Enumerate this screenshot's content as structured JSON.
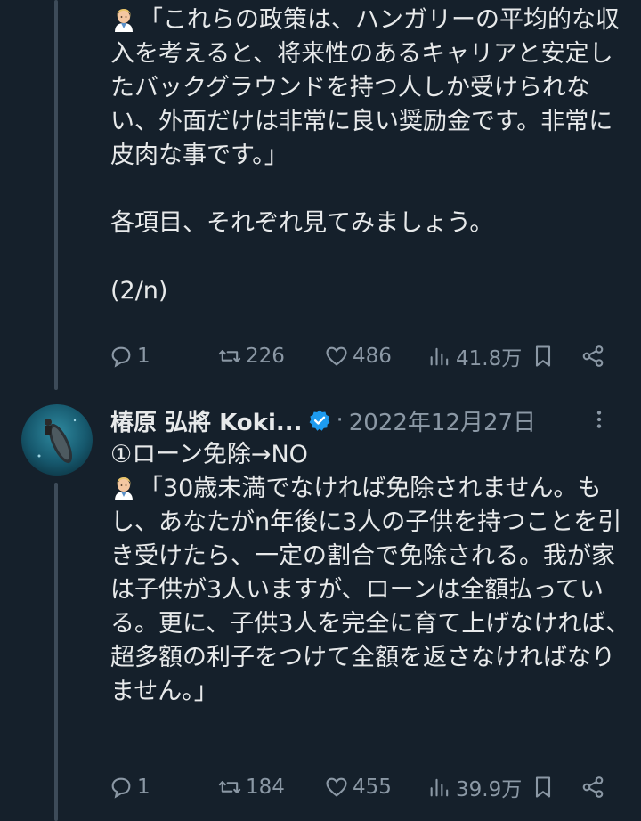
{
  "tweet1": {
    "text": "「これらの政策は、ハンガリーの平均的な収入を考えると、将来性のあるキャリアと安定したバックグラウンドを持つ人しか受けられない、外面だけは非常に良い奨励金です。非常に皮肉な事です。」\n\n各項目、それぞれ見てみましょう。\n\n(2/n)",
    "emoji": "health-worker-emoji",
    "replies": "1",
    "retweets": "226",
    "likes": "486",
    "views": "41.8万"
  },
  "tweet2": {
    "author_name": "椿原 弘將 Koki...",
    "separator": "·",
    "date": "2022年12月27日",
    "heading": "①ローン免除→NO",
    "text": "「30歳未満でなければ免除されません。もし、あなたがn年後に3人の子供を持つことを引き受けたら、一定の割合で免除される。我が家は子供が3人いますが、ローンは全額払っている。更に、子供3人を完全に育て上げなければ、超多額の利子をつけて全額を返さなければなりません。」",
    "emoji": "health-worker-emoji",
    "replies": "1",
    "retweets": "184",
    "likes": "455",
    "views": "39.9万"
  },
  "colors": {
    "background": "#15202b",
    "text": "#e7e9ea",
    "muted": "#8b98a5",
    "verified": "#1d9bf0",
    "thread_line": "#3d4b59"
  },
  "icons": [
    "reply-icon",
    "retweet-icon",
    "like-icon",
    "views-icon",
    "bookmark-icon",
    "share-icon",
    "more-icon",
    "verified-icon"
  ]
}
